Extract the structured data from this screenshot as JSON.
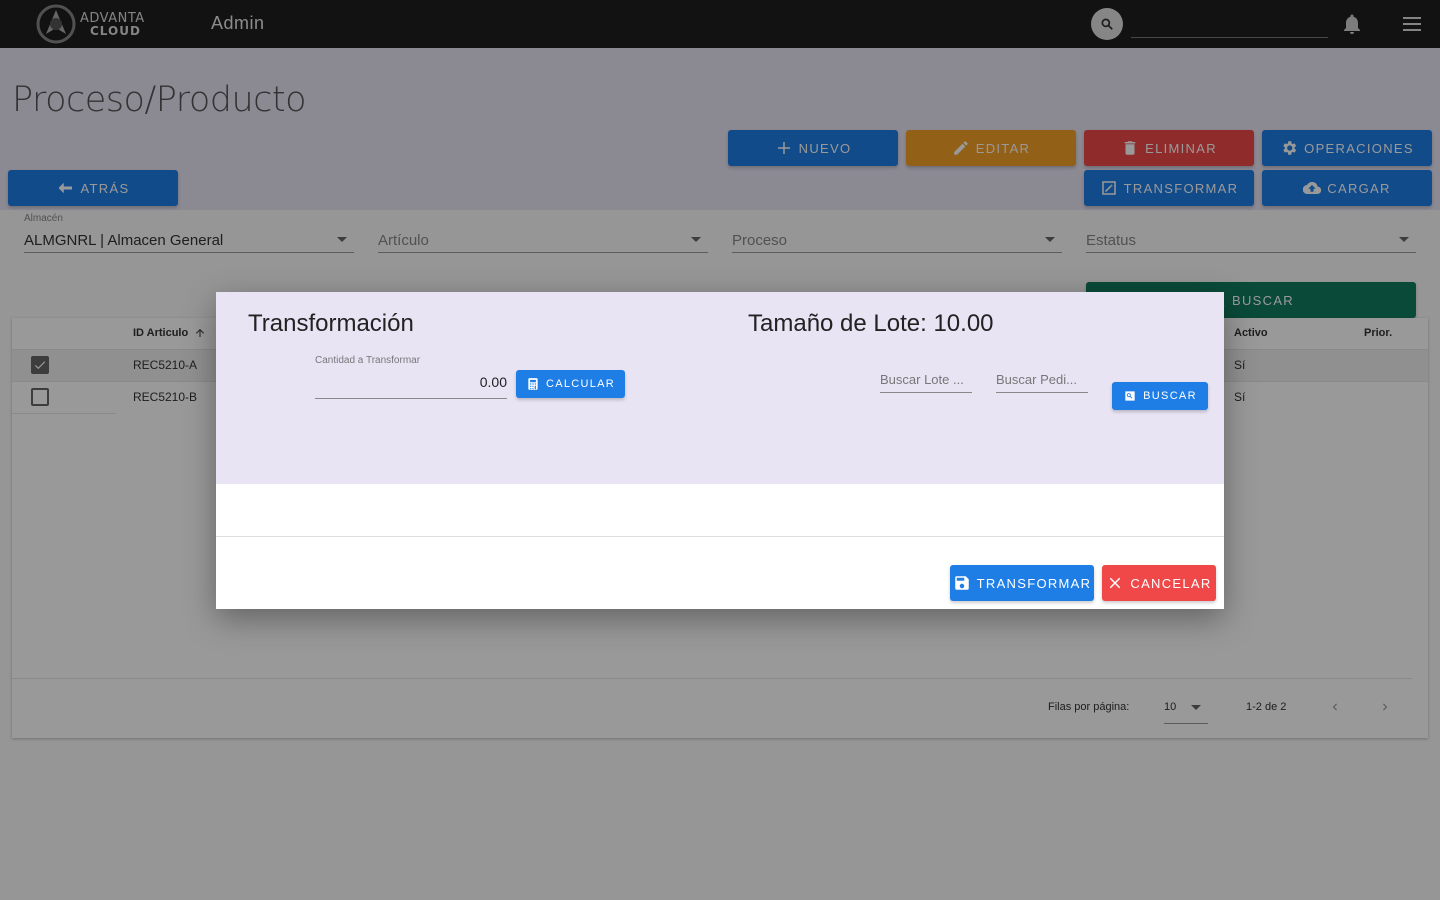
{
  "topbar": {
    "logo_line1": "ADVANTA",
    "logo_line2": "CLOUD",
    "section": "Admin",
    "search_placeholder": ""
  },
  "page": {
    "title": "Proceso/Producto"
  },
  "toolbar": {
    "nuevo": "NUEVO",
    "editar": "EDITAR",
    "eliminar": "ELIMINAR",
    "operaciones": "OPERACIONES",
    "transformar": "TRANSFORMAR",
    "cargar": "CARGAR",
    "atras": "ATRÁS",
    "buscar": "BUSCAR"
  },
  "filters": {
    "almacen_label": "Almacén",
    "almacen_value": "ALMGNRL | Almacen General",
    "articulo_placeholder": "Artículo",
    "proceso_placeholder": "Proceso",
    "estatus_placeholder": "Estatus"
  },
  "table": {
    "columns": {
      "id_articulo": "ID Articulo",
      "activo": "Activo",
      "prior": "Prior."
    },
    "rows": [
      {
        "id": "REC5210-A",
        "activo": "Sí",
        "checked": true
      },
      {
        "id": "REC5210-B",
        "activo": "Sí",
        "checked": false
      }
    ],
    "pagination": {
      "rows_per_page_label": "Filas por página:",
      "rows_per_page": "10",
      "range": "1-2 de 2"
    }
  },
  "dialog": {
    "title": "Transformación",
    "lote_size": "Tamaño de Lote: 10.00",
    "cantidad_label": "Cantidad a Transformar",
    "cantidad_value": "0.00",
    "calcular": "CALCULAR",
    "buscar_lote_placeholder": "Buscar Lote ...",
    "buscar_pedido_placeholder": "Buscar Pedi...",
    "buscar": "BUSCAR",
    "transformar": "TRANSFORMAR",
    "cancelar": "CANCELAR"
  },
  "colors": {
    "topbar": "#1e1e1e",
    "header_bg": "#e8e4f4",
    "primary": "#1e7ee6",
    "warning": "#f5a028",
    "danger": "#f04848",
    "success": "#127c5e"
  }
}
